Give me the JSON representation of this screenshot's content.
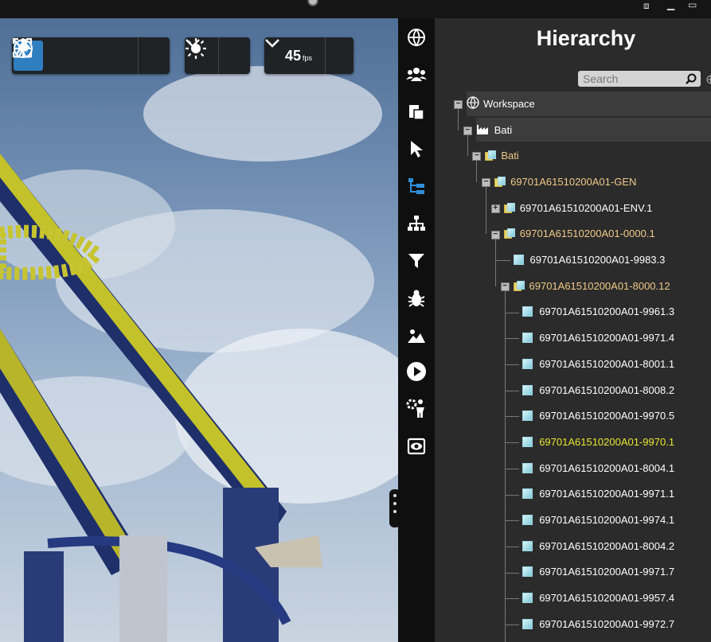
{
  "window": {
    "restore_icon": "⧈",
    "minimize_icon": "▁",
    "maximize_icon": "▭"
  },
  "toolbar": {
    "fps_value": "45",
    "fps_unit": "fps",
    "modes": [
      "run-mode-icon",
      "walk-mode-icon",
      "target-mode-icon",
      "focus-mode-icon"
    ],
    "active_mode": "run-mode-icon"
  },
  "sidebar_icons": [
    "globe-icon",
    "users-icon",
    "layers-icon",
    "cursor-icon",
    "tree-hierarchy-icon",
    "org-chart-icon",
    "filter-icon",
    "bug-icon",
    "landscape-icon",
    "play-icon",
    "person-gear-icon",
    "view-icon"
  ],
  "hierarchy": {
    "title": "Hierarchy",
    "search_placeholder": "Search",
    "colors": {
      "normal": "#ffffff",
      "group": "#f0c987",
      "selected": "#e6e633",
      "highlight_row": "#3c3c3c"
    },
    "items": [
      {
        "label": "Workspace",
        "depth": 0,
        "icon": "globe-icon",
        "toggle": "minus",
        "color": "normal",
        "row_highlight": true
      },
      {
        "label": "Bati",
        "depth": 1,
        "icon": "factory-icon",
        "toggle": "minus",
        "color": "normal",
        "row_highlight": true
      },
      {
        "label": "Bati",
        "depth": 2,
        "icon": "group-icon",
        "toggle": "minus",
        "color": "group"
      },
      {
        "label": "69701A61510200A01-GEN",
        "depth": 3,
        "icon": "group-icon",
        "toggle": "minus",
        "color": "group"
      },
      {
        "label": "69701A61510200A01-ENV.1",
        "depth": 4,
        "icon": "group-icon",
        "toggle": "plus",
        "color": "normal"
      },
      {
        "label": "69701A61510200A01-0000.1",
        "depth": 4,
        "icon": "group-icon",
        "toggle": "minus",
        "color": "group"
      },
      {
        "label": "69701A61510200A01-9983.3",
        "depth": 5,
        "icon": "cube-icon",
        "toggle": "none",
        "color": "normal"
      },
      {
        "label": "69701A61510200A01-8000.12",
        "depth": 5,
        "icon": "group-icon",
        "toggle": "minus",
        "color": "group"
      },
      {
        "label": "69701A61510200A01-9961.3",
        "depth": 6,
        "icon": "cube-icon",
        "toggle": "none",
        "color": "normal"
      },
      {
        "label": "69701A61510200A01-9971.4",
        "depth": 6,
        "icon": "cube-icon",
        "toggle": "none",
        "color": "normal"
      },
      {
        "label": "69701A61510200A01-8001.1",
        "depth": 6,
        "icon": "cube-icon",
        "toggle": "none",
        "color": "normal"
      },
      {
        "label": "69701A61510200A01-8008.2",
        "depth": 6,
        "icon": "cube-icon",
        "toggle": "none",
        "color": "normal"
      },
      {
        "label": "69701A61510200A01-9970.5",
        "depth": 6,
        "icon": "cube-icon",
        "toggle": "none",
        "color": "normal"
      },
      {
        "label": "69701A61510200A01-9970.1",
        "depth": 6,
        "icon": "cube-icon",
        "toggle": "none",
        "color": "selected"
      },
      {
        "label": "69701A61510200A01-8004.1",
        "depth": 6,
        "icon": "cube-icon",
        "toggle": "none",
        "color": "normal"
      },
      {
        "label": "69701A61510200A01-9971.1",
        "depth": 6,
        "icon": "cube-icon",
        "toggle": "none",
        "color": "normal"
      },
      {
        "label": "69701A61510200A01-9974.1",
        "depth": 6,
        "icon": "cube-icon",
        "toggle": "none",
        "color": "normal"
      },
      {
        "label": "69701A61510200A01-8004.2",
        "depth": 6,
        "icon": "cube-icon",
        "toggle": "none",
        "color": "normal"
      },
      {
        "label": "69701A61510200A01-9971.7",
        "depth": 6,
        "icon": "cube-icon",
        "toggle": "none",
        "color": "normal"
      },
      {
        "label": "69701A61510200A01-9957.4",
        "depth": 6,
        "icon": "cube-icon",
        "toggle": "none",
        "color": "normal"
      },
      {
        "label": "69701A61510200A01-9972.7",
        "depth": 6,
        "icon": "cube-icon",
        "toggle": "none",
        "color": "normal"
      }
    ]
  }
}
